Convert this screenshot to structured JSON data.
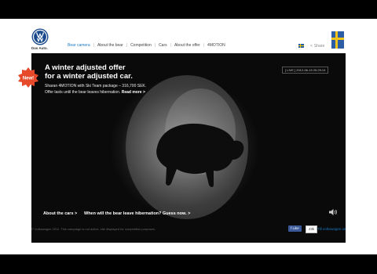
{
  "brand": {
    "logo_text": "Das Auto."
  },
  "nav": {
    "items": [
      {
        "label": "Bear camera",
        "active": true
      },
      {
        "label": "About the bear",
        "active": false
      },
      {
        "label": "Competition",
        "active": false
      },
      {
        "label": "Cars",
        "active": false
      },
      {
        "label": "About the offer",
        "active": false
      },
      {
        "label": "4MOTION",
        "active": false
      }
    ]
  },
  "header": {
    "share_label": "Share"
  },
  "hero": {
    "new_badge": "New!",
    "headline_line1": "A winter adjusted offer",
    "headline_line2": "for a winter adjusted car.",
    "offer_line1": "Sharan 4MOTION with Ski Team package – 316,700 SEK.",
    "offer_line2": "Offer lasts until the bear leaves hibernation.",
    "read_more": "Read more >",
    "camera_label": "[ LIVE ]  2012-06-19    20:29:13",
    "about_cars": "About the cars >",
    "question": "When will the bear leave hibernation? Guess now. >"
  },
  "footer": {
    "copyright": "© Volkswagen 2011. This campaign is not active, site displayed for competition purposes.",
    "like_label": "Like",
    "like_count": "23k",
    "vw_link": "Till volkswagen.se"
  },
  "colors": {
    "accent_blue": "#1a78c2",
    "new_badge": "#e64a2a",
    "facebook": "#3b5998"
  }
}
